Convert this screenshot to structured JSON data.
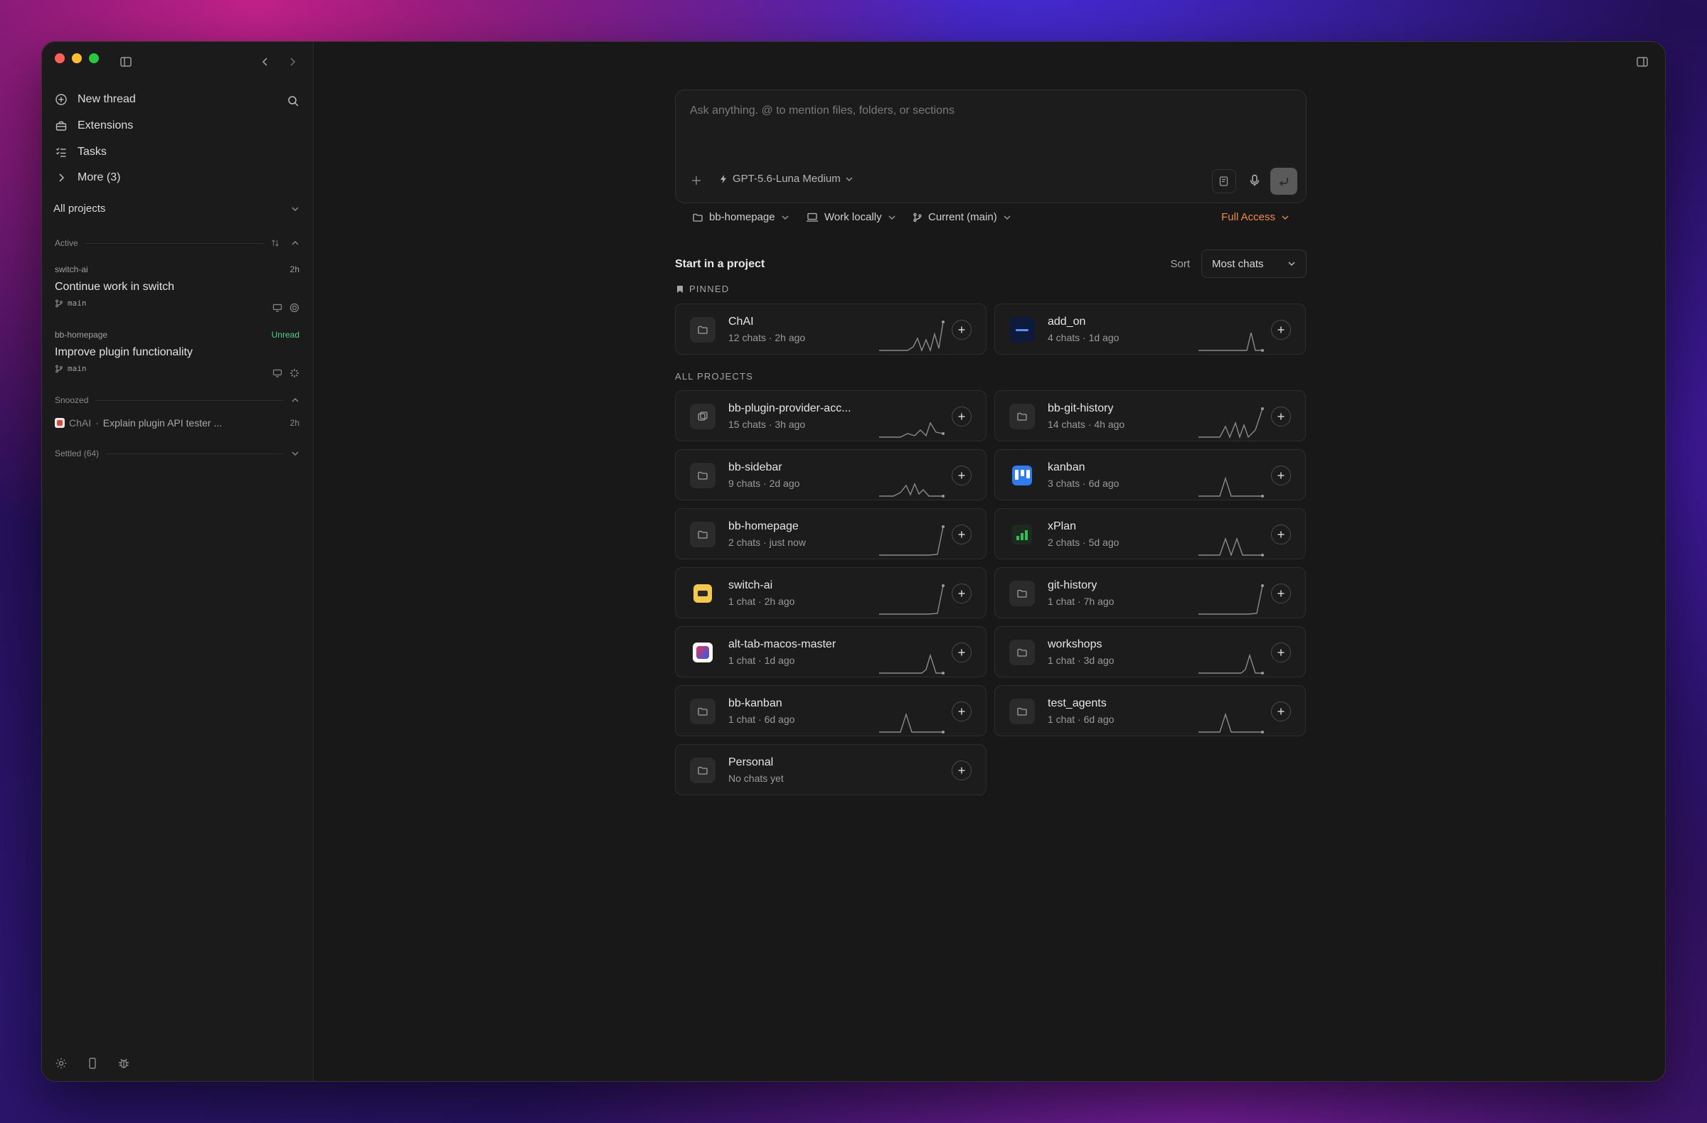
{
  "sidebar": {
    "nav": [
      {
        "label": "New thread",
        "icon": "plus-circle-icon"
      },
      {
        "label": "Extensions",
        "icon": "briefcase-icon"
      },
      {
        "label": "Tasks",
        "icon": "checklist-icon"
      },
      {
        "label": "More (3)",
        "icon": "chevron-right-icon"
      }
    ],
    "projects_filter": "All projects",
    "active_label": "Active",
    "threads": [
      {
        "project": "switch-ai",
        "time": "2h",
        "title": "Continue work in switch",
        "branch": "main"
      },
      {
        "project": "bb-homepage",
        "time": "Unread",
        "title": "Improve plugin functionality",
        "branch": "main"
      }
    ],
    "snoozed_label": "Snoozed",
    "snoozed_item": {
      "project": "ChAI",
      "sep": "·",
      "title": "Explain plugin API tester ...",
      "time": "2h"
    },
    "settled_label": "Settled (64)"
  },
  "composer": {
    "placeholder": "Ask anything. @ to mention files, folders, or sections",
    "model": "GPT-5.6-Luna Medium"
  },
  "context": {
    "project": "bb-homepage",
    "location": "Work locally",
    "branch": "Current (main)",
    "access": "Full Access"
  },
  "projects": {
    "heading": "Start in a project",
    "sort_label": "Sort",
    "sort_value": "Most chats",
    "pinned_label": "PINNED",
    "all_label": "ALL PROJECTS",
    "pinned": [
      {
        "name": "ChAI",
        "meta": "12 chats · 2h ago",
        "icon": "folder-icon",
        "spark": "peaks-end"
      },
      {
        "name": "add_on",
        "meta": "4 chats · 1d ago",
        "icon": "add-on-logo-icon",
        "spark": "single-peak"
      }
    ],
    "all": [
      {
        "name": "bb-plugin-provider-acc...",
        "meta": "15 chats · 3h ago",
        "icon": "plugin-icon"
      },
      {
        "name": "bb-git-history",
        "meta": "14 chats · 4h ago",
        "icon": "folder-icon"
      },
      {
        "name": "bb-sidebar",
        "meta": "9 chats · 2d ago",
        "icon": "folder-icon"
      },
      {
        "name": "kanban",
        "meta": "3 chats · 6d ago",
        "icon": "kanban-logo-icon"
      },
      {
        "name": "bb-homepage",
        "meta": "2 chats · just now",
        "icon": "folder-icon"
      },
      {
        "name": "xPlan",
        "meta": "2 chats · 5d ago",
        "icon": "xplan-logo-icon"
      },
      {
        "name": "switch-ai",
        "meta": "1 chat · 2h ago",
        "icon": "switch-ai-logo-icon"
      },
      {
        "name": "git-history",
        "meta": "1 chat · 7h ago",
        "icon": "folder-icon"
      },
      {
        "name": "alt-tab-macos-master",
        "meta": "1 chat · 1d ago",
        "icon": "alt-tab-logo-icon"
      },
      {
        "name": "workshops",
        "meta": "1 chat · 3d ago",
        "icon": "folder-icon"
      },
      {
        "name": "bb-kanban",
        "meta": "1 chat · 6d ago",
        "icon": "folder-icon"
      },
      {
        "name": "test_agents",
        "meta": "1 chat · 6d ago",
        "icon": "folder-icon"
      },
      {
        "name": "Personal",
        "meta": "No chats yet",
        "icon": "folder-icon"
      }
    ]
  },
  "colors": {
    "accent_orange": "#f0894a",
    "unread_green": "#4fd08a"
  }
}
